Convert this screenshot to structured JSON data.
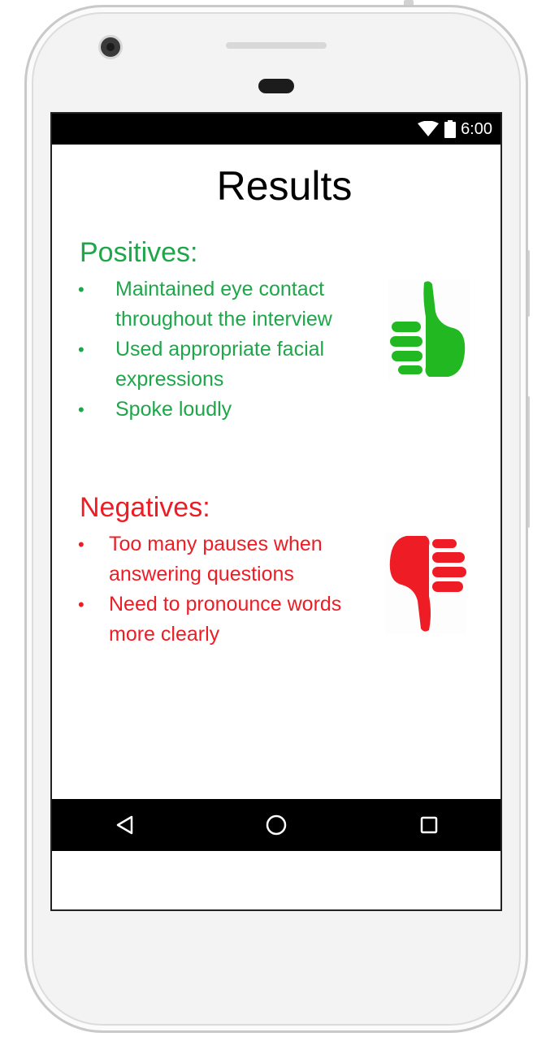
{
  "status_bar": {
    "time": "6:00",
    "icons": [
      "wifi-icon",
      "battery-icon"
    ]
  },
  "page": {
    "title": "Results"
  },
  "positives": {
    "heading": "Positives:",
    "color": "#1fa64a",
    "items": [
      "Maintained eye contact throughout the interview",
      "Used appropriate facial expressions",
      "Spoke loudly"
    ],
    "icon": "thumbs-up-icon"
  },
  "negatives": {
    "heading": "Negatives:",
    "color": "#ee1c25",
    "items": [
      "Too many pauses when answering questions",
      "Need to pronounce words more clearly"
    ],
    "icon": "thumbs-down-icon"
  },
  "nav_bar": {
    "buttons": [
      "back-icon",
      "home-icon",
      "recents-icon"
    ]
  }
}
